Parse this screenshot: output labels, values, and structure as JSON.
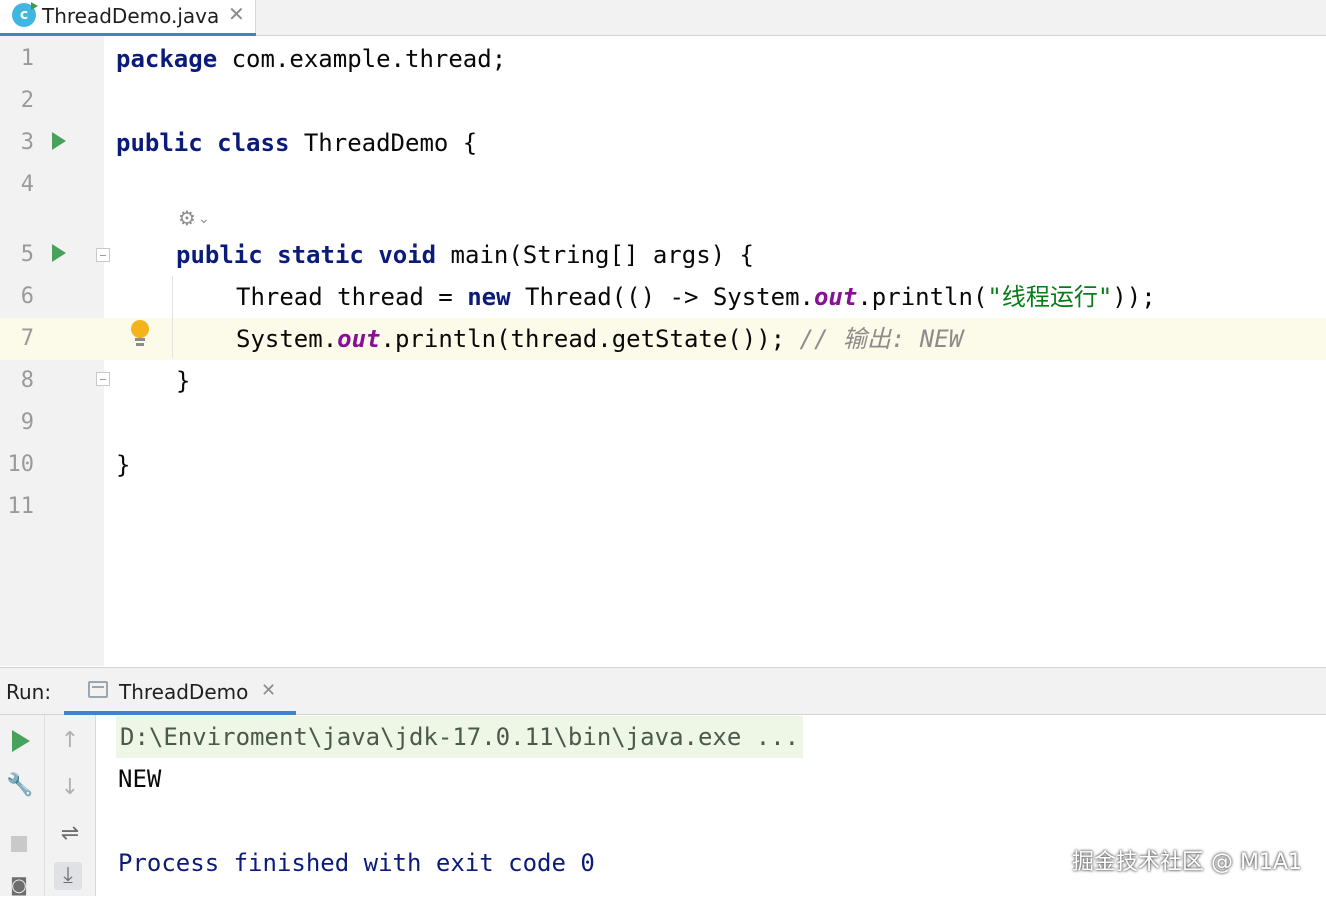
{
  "editor_tab": {
    "label": "ThreadDemo.java",
    "icon": "java-class-icon"
  },
  "gutter": {
    "line_numbers": [
      "1",
      "2",
      "3",
      "4",
      "5",
      "6",
      "7",
      "8",
      "9",
      "10",
      "11"
    ],
    "current_line": "7"
  },
  "code": {
    "l1_kw": "package",
    "l1_rest": " com.example.thread;",
    "l3_kw1": "public",
    "l3_kw2": "class",
    "l3_rest": " ThreadDemo {",
    "l5_kw1": "public",
    "l5_kw2": "static",
    "l5_kw3": "void",
    "l5_rest": " main(String[] args) {",
    "l6_a": "Thread thread = ",
    "l6_kw": "new",
    "l6_b": " Thread(() -> System.",
    "l6_fld": "out",
    "l6_c": ".println(",
    "l6_str": "\"线程运行\"",
    "l6_d": "));",
    "l7_a": "System.",
    "l7_fld": "out",
    "l7_b": ".println(thread.getState()); ",
    "l7_cmt": "// 输出: NEW",
    "l8": "}",
    "l10": "}"
  },
  "run_panel": {
    "title": "Run:",
    "tab_label": "ThreadDemo",
    "console": {
      "command": "D:\\Enviroment\\java\\jdk-17.0.11\\bin\\java.exe ...",
      "output": "NEW",
      "exit": "Process finished with exit code 0"
    }
  },
  "watermark": "掘金技术社区 @ M1A1",
  "colors": {
    "keyword": "#0b1b7a",
    "string": "#067d17",
    "field": "#871094",
    "comment": "#8c8c8c",
    "accent": "#4083c9",
    "run_green": "#49a25b"
  }
}
